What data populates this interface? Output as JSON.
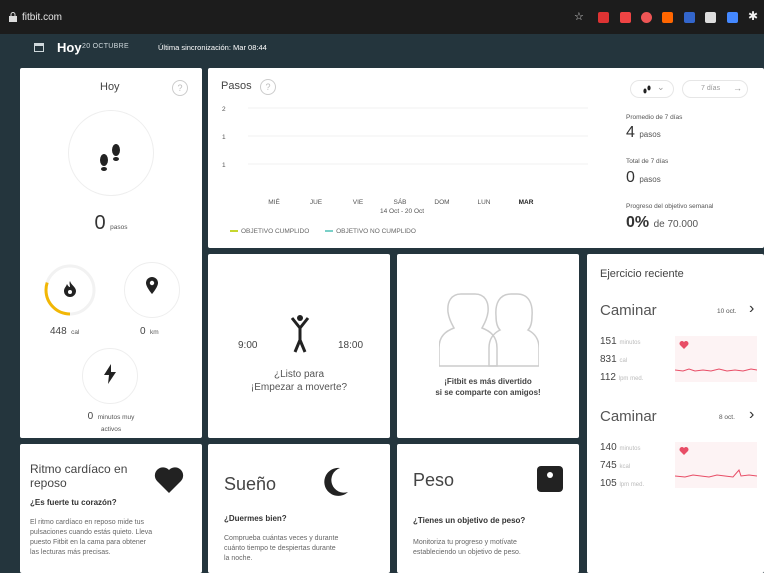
{
  "browser": {
    "url": "fitbit.com"
  },
  "header": {
    "today_label": "Hoy",
    "date": "20 OCTUBRE",
    "sync": "Última sincronización: Mar 08:44"
  },
  "today_card": {
    "title": "Hoy",
    "help": "?",
    "steps_value": "0",
    "steps_unit": "pasos",
    "calories_value": "448",
    "calories_unit": "cal",
    "calories_progress": 0.3,
    "distance_value": "0",
    "distance_unit": "km",
    "active_value": "0",
    "active_unit_line1": "minutos muy",
    "active_unit_line2": "activos"
  },
  "steps_card": {
    "title": "Pasos",
    "help": "?",
    "range_label": "7 días",
    "range_arrow": "→",
    "dropdown_arrow": "⌄",
    "avg_label": "Promedio de 7 días",
    "avg_value": "4",
    "avg_unit": "pasos",
    "total_label": "Total de 7 días",
    "total_value": "0",
    "total_unit": "pasos",
    "goal_label": "Progreso del objetivo semanal",
    "goal_value": "0%",
    "goal_unit": "de 70.000",
    "date_range": "14 Oct - 20 Oct",
    "legend_met": "OBJETIVO CUMPLIDO",
    "legend_not_met": "OBJETIVO NO CUMPLIDO"
  },
  "chart_data": {
    "type": "bar",
    "categories": [
      "MIÉ",
      "JUE",
      "VIE",
      "SÁB",
      "DOM",
      "LUN",
      "MAR"
    ],
    "values": [
      0,
      0,
      0,
      0,
      0,
      0,
      0
    ],
    "ylim": [
      0,
      2
    ],
    "yticks": [
      "2",
      "1",
      "1"
    ],
    "highlight_category": "MAR"
  },
  "hourly_card": {
    "start": "9:00",
    "end": "18:00",
    "line1": "¿Listo para",
    "line2": "¡Empezar a moverte?"
  },
  "friends_card": {
    "line1": "¡Fitbit es más divertido",
    "line2": "si se comparte con amigos!"
  },
  "exercise_card": {
    "title": "Ejercicio reciente",
    "items": [
      {
        "name": "Caminar",
        "meta": "10 oct.",
        "minutes": "151",
        "minutes_unit": "minutos",
        "calories": "831",
        "calories_unit": "cal",
        "hr": "112",
        "hr_unit": "lpm med."
      },
      {
        "name": "Caminar",
        "meta": "8 oct.",
        "minutes": "140",
        "minutes_unit": "minutos",
        "calories": "745",
        "calories_unit": "kcal",
        "hr": "105",
        "hr_unit": "lpm med."
      }
    ],
    "chevron": "›"
  },
  "rhr_card": {
    "title_line1": "Ritmo cardíaco en",
    "title_line2": "reposo",
    "question": "¿Es fuerte tu corazón?",
    "body_line1": "El ritmo cardíaco en reposo mide tus",
    "body_line2": "pulsaciones cuando estás quieto. Lleva",
    "body_line3": "puesto Fitbit en la cama para obtener",
    "body_line4": "las lecturas más precisas."
  },
  "sleep_card": {
    "title": "Sueño",
    "question": "¿Duermes bien?",
    "body_line1": "Comprueba cuántas veces y durante",
    "body_line2": "cuánto tiempo te despiertas durante",
    "body_line3": "la noche."
  },
  "weight_card": {
    "title": "Peso",
    "question": "¿Tienes un objetivo de peso?",
    "body_line1": "Monitoriza tu progreso y motívate",
    "body_line2": "estableciendo un objetivo de peso."
  },
  "colors": {
    "header_bg": "#24353d",
    "goal_met": "#c6d62f",
    "goal_not_met": "#7ad0c8",
    "calories_ring": "#f2b705",
    "hr_red": "#e84d66"
  }
}
